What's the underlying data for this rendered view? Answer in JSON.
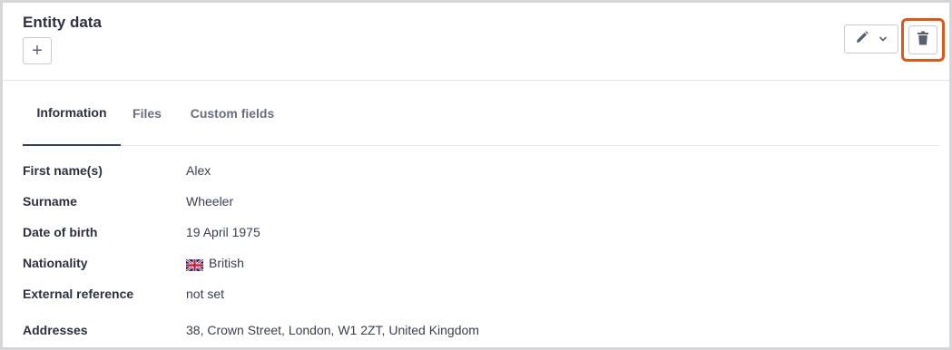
{
  "header": {
    "title": "Entity data",
    "add_label": "+"
  },
  "tabs": [
    {
      "label": "Information",
      "active": true
    },
    {
      "label": "Files",
      "active": false
    },
    {
      "label": "Custom fields",
      "active": false
    }
  ],
  "fields": [
    {
      "label": "First name(s)",
      "value": "Alex"
    },
    {
      "label": "Surname",
      "value": "Wheeler"
    },
    {
      "label": "Date of birth",
      "value": "19 April 1975"
    },
    {
      "label": "Nationality",
      "value": "British",
      "icon": "uk-flag-icon"
    },
    {
      "label": "External reference",
      "value": "not set"
    },
    {
      "label": "Addresses",
      "value": "38, Crown Street, London, W1 2ZT, United Kingdom"
    }
  ],
  "colors": {
    "highlight": "#d9581c",
    "active_tab_underline": "#3b3f55"
  }
}
